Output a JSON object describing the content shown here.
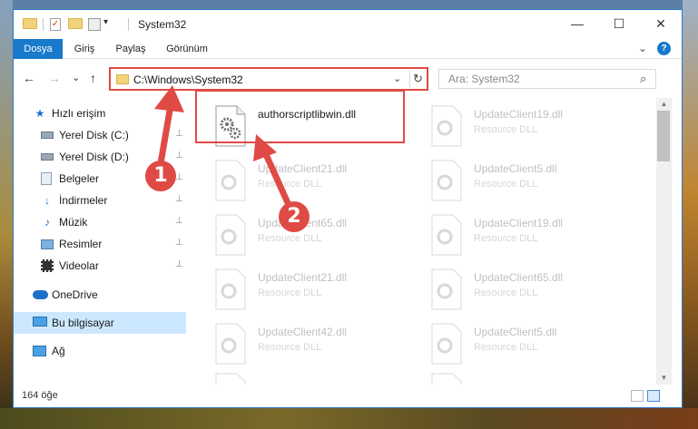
{
  "title": "System32",
  "window_controls": {
    "minimize": "—",
    "maximize": "☐",
    "close": "✕"
  },
  "quick_access_toolbar": {
    "dropdown": "▾"
  },
  "ribbon": {
    "tabs": [
      "Dosya",
      "Giriş",
      "Paylaş",
      "Görünüm"
    ],
    "expand": "⌄",
    "help": "?"
  },
  "nav": {
    "back": "←",
    "forward": "→",
    "recent": "⌄",
    "up": "↑"
  },
  "address": {
    "path": "C:\\Windows\\System32",
    "dropdown": "⌄",
    "refresh": "↻"
  },
  "search": {
    "placeholder": "Ara: System32",
    "icon": "⌕"
  },
  "sidebar": {
    "quick_access": {
      "label": "Hızlı erişim",
      "icon": "star-icon"
    },
    "items": [
      {
        "label": "Yerel Disk (C:)",
        "icon": "drive-icon",
        "pinned": true
      },
      {
        "label": "Yerel Disk (D:)",
        "icon": "drive-icon",
        "pinned": true
      },
      {
        "label": "Belgeler",
        "icon": "documents-icon",
        "pinned": true
      },
      {
        "label": "İndirmeler",
        "icon": "download-icon",
        "pinned": true
      },
      {
        "label": "Müzik",
        "icon": "music-icon",
        "pinned": true
      },
      {
        "label": "Resimler",
        "icon": "pictures-icon",
        "pinned": true
      },
      {
        "label": "Videolar",
        "icon": "videos-icon",
        "pinned": true
      }
    ],
    "onedrive": "OneDrive",
    "this_pc": "Bu bilgisayar",
    "network": "Ağ",
    "pin_glyph": "📌"
  },
  "files": [
    {
      "name": "authorscriptlibwin.dll",
      "type": "",
      "highlighted": true
    },
    {
      "name": "UpdateClient19.dll",
      "type": "Resource DLL"
    },
    {
      "name": "UpdateClient21.dll",
      "type": "Resource DLL"
    },
    {
      "name": "UpdateClient5.dll",
      "type": "Resource DLL"
    },
    {
      "name": "UpdateClient65.dll",
      "type": "Resource DLL"
    },
    {
      "name": "UpdateClient19.dll",
      "type": "Resource DLL"
    },
    {
      "name": "UpdateClient21.dll",
      "type": "Resource DLL"
    },
    {
      "name": "UpdateClient65.dll",
      "type": "Resource DLL"
    },
    {
      "name": "UpdateClient42.dll",
      "type": "Resource DLL"
    },
    {
      "name": "UpdateClient5.dll",
      "type": "Resource DLL"
    },
    {
      "name": "",
      "type": ""
    },
    {
      "name": "",
      "type": ""
    }
  ],
  "status": {
    "item_count": "164 öğe"
  },
  "callouts": [
    "1",
    "2"
  ],
  "colors": {
    "accent": "#1979ca",
    "highlight": "#e04a45",
    "selected_bg": "#cce8ff"
  }
}
